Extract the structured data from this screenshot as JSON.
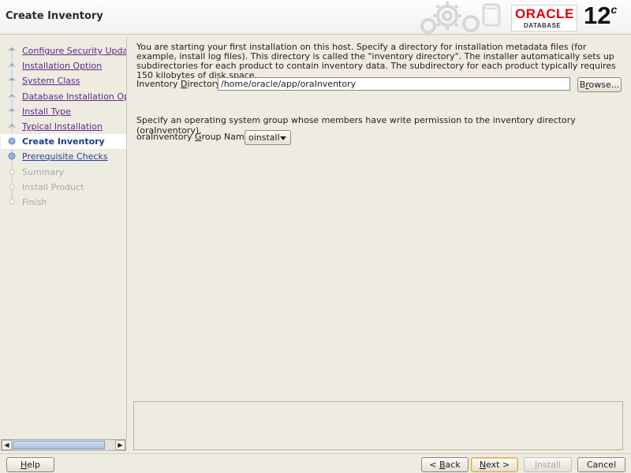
{
  "window": {
    "title": "Create Inventory"
  },
  "branding": {
    "oracle": "ORACLE",
    "database": "DATABASE",
    "version": "12",
    "version_sup": "c",
    "red": "#e00000"
  },
  "steps": [
    {
      "label": "Configure Security Updates",
      "state": "visited"
    },
    {
      "label": "Installation Option",
      "state": "visited"
    },
    {
      "label": "System Class",
      "state": "visited"
    },
    {
      "label": "Database Installation Options",
      "state": "visited"
    },
    {
      "label": "Install Type",
      "state": "visited"
    },
    {
      "label": "Typical Installation",
      "state": "visited"
    },
    {
      "label": "Create Inventory",
      "state": "current"
    },
    {
      "label": "Prerequisite Checks",
      "state": "next"
    },
    {
      "label": "Summary",
      "state": "disabled"
    },
    {
      "label": "Install Product",
      "state": "disabled"
    },
    {
      "label": "Finish",
      "state": "disabled"
    }
  ],
  "main": {
    "description": "You are starting your first installation on this host. Specify a directory for installation metadata files (for example, install log files). This directory is called the \"inventory directory\". The installer automatically sets up subdirectories for each product to contain inventory data. The subdirectory for each product typically requires 150 kilobytes of disk space.",
    "inventory_label_pre": "Inventory ",
    "inventory_label_mn": "D",
    "inventory_label_post": "irectory:",
    "inventory_value": "/home/oracle/app/oraInventory",
    "browse_pre": "B",
    "browse_mn": "r",
    "browse_post": "owse...",
    "group_desc": "Specify an operating system group whose members have write permission to the inventory directory (oraInventory).",
    "group_label_pre": "oraInventory ",
    "group_label_mn": "G",
    "group_label_post": "roup Name:",
    "group_value": "oinstall"
  },
  "footer": {
    "help_mn": "H",
    "help_post": "elp",
    "back_pre": "< ",
    "back_mn": "B",
    "back_post": "ack",
    "next_mn": "N",
    "next_post": "ext >",
    "install_mn": "I",
    "install_post": "nstall",
    "cancel": "Cancel"
  }
}
